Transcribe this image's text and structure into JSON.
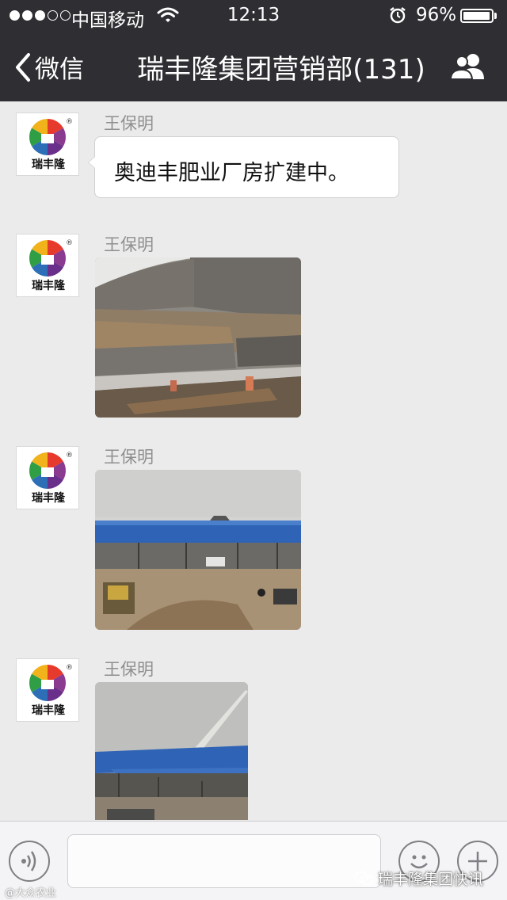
{
  "status_bar": {
    "carrier": "中国移动",
    "time": "12:13",
    "battery_percent": "96%",
    "battery_level": 0.96,
    "signal_bars_filled": 3,
    "signal_bars_total": 5
  },
  "nav": {
    "back_label": "微信",
    "title": "瑞丰隆集团营销部(131)",
    "back_icon": "chevron-left-icon",
    "members_icon": "group-members-icon"
  },
  "messages": [
    {
      "sender": "王保明",
      "type": "text",
      "text": "奥迪丰肥业厂房扩建中。",
      "avatar_text": "瑞丰隆"
    },
    {
      "sender": "王保明",
      "type": "image",
      "avatar_text": "瑞丰隆"
    },
    {
      "sender": "王保明",
      "type": "image",
      "avatar_text": "瑞丰隆"
    },
    {
      "sender": "王保明",
      "type": "image",
      "avatar_text": "瑞丰隆"
    }
  ],
  "input_bar": {
    "voice_icon": "voice-icon",
    "emoji_icon": "emoji-icon",
    "plus_icon": "plus-icon"
  },
  "watermarks": {
    "left": "@大众农业",
    "right": "瑞丰隆集团快讯"
  },
  "colors": {
    "nav_background": "#2f2f33",
    "chat_background": "#ebebeb",
    "sender_name": "#8f8f8f",
    "roof_blue": "#2f63b5"
  }
}
